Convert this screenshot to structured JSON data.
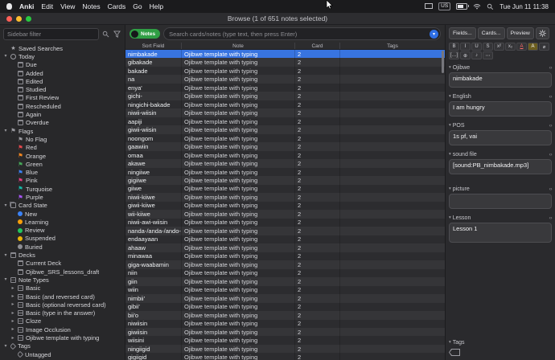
{
  "menubar": {
    "left_items": [
      "Anki",
      "Edit",
      "View",
      "Notes",
      "Cards",
      "Go",
      "Help"
    ],
    "input_source": "US",
    "time": "Tue Jun 11 11:38"
  },
  "titlebar": {
    "title": "Browse (1 of 651 notes selected)"
  },
  "toolbar": {
    "sidebar_filter_placeholder": "Sidebar filter",
    "notes_switch_label": "Notes",
    "search_placeholder": "Search cards/notes (type text, then press Enter)"
  },
  "right_toolbar": {
    "fields_button": "Fields...",
    "cards_button": "Cards...",
    "preview_button": "Preview"
  },
  "editor_toolbar": {
    "buttons": [
      {
        "name": "bold-button",
        "glyph": "B"
      },
      {
        "name": "italic-button",
        "glyph": "I"
      },
      {
        "name": "underline-button",
        "glyph": "U"
      },
      {
        "name": "strikethrough-button",
        "glyph": "S"
      },
      {
        "name": "superscript-button",
        "glyph": "x²"
      },
      {
        "name": "subscript-button",
        "glyph": "x₂"
      },
      {
        "name": "text-color-button",
        "glyph": "A",
        "style": "color-red"
      },
      {
        "name": "highlight-button",
        "glyph": "A",
        "style": "hl"
      },
      {
        "name": "eraser-button",
        "glyph": "⌀"
      },
      {
        "name": "cloze-button",
        "glyph": "[…]"
      },
      {
        "name": "attachment-button",
        "glyph": "⊕"
      },
      {
        "name": "record-audio-button",
        "glyph": "♪"
      },
      {
        "name": "more-button",
        "glyph": "⋯"
      }
    ]
  },
  "sidebar": {
    "sections": [
      {
        "label": "Saved Searches",
        "icon": "star",
        "children": []
      },
      {
        "label": "Today",
        "icon": "clock",
        "caret": "down",
        "children": [
          {
            "label": "Due",
            "icon": "cal"
          },
          {
            "label": "Added",
            "icon": "cal"
          },
          {
            "label": "Edited",
            "icon": "cal"
          },
          {
            "label": "Studied",
            "icon": "cal"
          },
          {
            "label": "First Review",
            "icon": "cal"
          },
          {
            "label": "Rescheduled",
            "icon": "cal"
          },
          {
            "label": "Again",
            "icon": "cal"
          },
          {
            "label": "Overdue",
            "icon": "cal"
          }
        ]
      },
      {
        "label": "Flags",
        "icon": "flag",
        "color": "#9a9aa0",
        "caret": "down",
        "children": [
          {
            "label": "No Flag",
            "icon": "flag",
            "color": "#9a9aa0"
          },
          {
            "label": "Red",
            "icon": "flag",
            "color": "#e5484d"
          },
          {
            "label": "Orange",
            "icon": "flag",
            "color": "#f5871f"
          },
          {
            "label": "Green",
            "icon": "flag",
            "color": "#46a758"
          },
          {
            "label": "Blue",
            "icon": "flag",
            "color": "#3b82f6"
          },
          {
            "label": "Pink",
            "icon": "flag",
            "color": "#e93d82"
          },
          {
            "label": "Turquoise",
            "icon": "flag",
            "color": "#14b8a6"
          },
          {
            "label": "Purple",
            "icon": "flag",
            "color": "#a855f7"
          }
        ]
      },
      {
        "label": "Card State",
        "icon": "cards",
        "caret": "down",
        "children": [
          {
            "label": "New",
            "icon": "dot",
            "color": "#3b82f6"
          },
          {
            "label": "Learning",
            "icon": "dot",
            "color": "#f59e0b"
          },
          {
            "label": "Review",
            "icon": "dot",
            "color": "#22c55e"
          },
          {
            "label": "Suspended",
            "icon": "dot",
            "color": "#eab308"
          },
          {
            "label": "Buried",
            "icon": "dot",
            "color": "#8e8e93"
          }
        ]
      },
      {
        "label": "Decks",
        "icon": "deck",
        "caret": "down",
        "children": [
          {
            "label": "Current Deck",
            "icon": "deck"
          },
          {
            "label": "Ojibwe_SRS_lessons_draft",
            "icon": "deck"
          }
        ]
      },
      {
        "label": "Note Types",
        "icon": "note",
        "caret": "down",
        "children": [
          {
            "label": "Basic",
            "icon": "note",
            "caret": "right"
          },
          {
            "label": "Basic (and reversed card)",
            "icon": "note",
            "caret": "right"
          },
          {
            "label": "Basic (optional reversed card)",
            "icon": "note",
            "caret": "right"
          },
          {
            "label": "Basic (type in the answer)",
            "icon": "note",
            "caret": "right"
          },
          {
            "label": "Cloze",
            "icon": "note",
            "caret": "right"
          },
          {
            "label": "Image Occlusion",
            "icon": "note",
            "caret": "right"
          },
          {
            "label": "Ojibwe template with typing",
            "icon": "note",
            "caret": "right"
          }
        ]
      },
      {
        "label": "Tags",
        "icon": "tag",
        "caret": "down",
        "children": [
          {
            "label": "Untagged",
            "icon": "tag"
          }
        ]
      }
    ]
  },
  "table": {
    "columns": [
      "Sort Field",
      "Note",
      "Card",
      "Tags"
    ],
    "rows": [
      {
        "sort_field": "nimbakade",
        "note": "Ojibwe template with typing",
        "card": "2",
        "tags": "",
        "selected": true
      },
      {
        "sort_field": "gibakade",
        "note": "Ojibwe template with typing",
        "card": "2",
        "tags": ""
      },
      {
        "sort_field": "bakade",
        "note": "Ojibwe template with typing",
        "card": "2",
        "tags": ""
      },
      {
        "sort_field": "na",
        "note": "Ojibwe template with typing",
        "card": "2",
        "tags": ""
      },
      {
        "sort_field": "enya'",
        "note": "Ojibwe template with typing",
        "card": "2",
        "tags": ""
      },
      {
        "sort_field": "gichi-",
        "note": "Ojibwe template with typing",
        "card": "2",
        "tags": ""
      },
      {
        "sort_field": "ningichi-bakade",
        "note": "Ojibwe template with typing",
        "card": "2",
        "tags": ""
      },
      {
        "sort_field": "niwii-wiisin",
        "note": "Ojibwe template with typing",
        "card": "2",
        "tags": ""
      },
      {
        "sort_field": "aapiji",
        "note": "Ojibwe template with typing",
        "card": "2",
        "tags": ""
      },
      {
        "sort_field": "giwii-wiisin",
        "note": "Ojibwe template with typing",
        "card": "2",
        "tags": ""
      },
      {
        "sort_field": "noongom",
        "note": "Ojibwe template with typing",
        "card": "2",
        "tags": ""
      },
      {
        "sort_field": "gaawiin",
        "note": "Ojibwe template with typing",
        "card": "2",
        "tags": ""
      },
      {
        "sort_field": "omaa",
        "note": "Ojibwe template with typing",
        "card": "2",
        "tags": ""
      },
      {
        "sort_field": "akawe",
        "note": "Ojibwe template with typing",
        "card": "2",
        "tags": ""
      },
      {
        "sort_field": "ningiiwe",
        "note": "Ojibwe template with typing",
        "card": "2",
        "tags": ""
      },
      {
        "sort_field": "gigiiwe",
        "note": "Ojibwe template with typing",
        "card": "2",
        "tags": ""
      },
      {
        "sort_field": "giiwe",
        "note": "Ojibwe template with typing",
        "card": "2",
        "tags": ""
      },
      {
        "sort_field": "niwii-kiiwe",
        "note": "Ojibwe template with typing",
        "card": "2",
        "tags": ""
      },
      {
        "sort_field": "giwii-kiiwe",
        "note": "Ojibwe template with typing",
        "card": "2",
        "tags": ""
      },
      {
        "sort_field": "wii-kiiwe",
        "note": "Ojibwe template with typing",
        "card": "2",
        "tags": ""
      },
      {
        "sort_field": "niwii-awi-wiisin",
        "note": "Ojibwe template with typing",
        "card": "2",
        "tags": ""
      },
      {
        "sort_field": "nanda-/anda-/ando-",
        "note": "Ojibwe template with typing",
        "card": "2",
        "tags": ""
      },
      {
        "sort_field": "endaayaan",
        "note": "Ojibwe template with typing",
        "card": "2",
        "tags": ""
      },
      {
        "sort_field": "ahaaw",
        "note": "Ojibwe template with typing",
        "card": "2",
        "tags": ""
      },
      {
        "sort_field": "minawaa",
        "note": "Ojibwe template with typing",
        "card": "2",
        "tags": ""
      },
      {
        "sort_field": "giga-waabamin",
        "note": "Ojibwe template with typing",
        "card": "2",
        "tags": ""
      },
      {
        "sort_field": "niin",
        "note": "Ojibwe template with typing",
        "card": "2",
        "tags": ""
      },
      {
        "sort_field": "giin",
        "note": "Ojibwe template with typing",
        "card": "2",
        "tags": ""
      },
      {
        "sort_field": "wiin",
        "note": "Ojibwe template with typing",
        "card": "2",
        "tags": ""
      },
      {
        "sort_field": "nimbii'",
        "note": "Ojibwe template with typing",
        "card": "2",
        "tags": ""
      },
      {
        "sort_field": "gibii'",
        "note": "Ojibwe template with typing",
        "card": "2",
        "tags": ""
      },
      {
        "sort_field": "bii'o",
        "note": "Ojibwe template with typing",
        "card": "2",
        "tags": ""
      },
      {
        "sort_field": "niwiisin",
        "note": "Ojibwe template with typing",
        "card": "2",
        "tags": ""
      },
      {
        "sort_field": "giwiisin",
        "note": "Ojibwe template with typing",
        "card": "2",
        "tags": ""
      },
      {
        "sort_field": "wiisini",
        "note": "Ojibwe template with typing",
        "card": "2",
        "tags": ""
      },
      {
        "sort_field": "ningiigid",
        "note": "Ojibwe template with typing",
        "card": "2",
        "tags": ""
      },
      {
        "sort_field": "gigiigid",
        "note": "Ojibwe template with typing",
        "card": "2",
        "tags": ""
      }
    ]
  },
  "editor": {
    "fields": [
      {
        "label": "Ojibwe",
        "value": "nimbakade"
      },
      {
        "label": "English",
        "value": "I am hungry"
      },
      {
        "label": "POS",
        "value": "1s pf, vai"
      },
      {
        "label": "sound file",
        "value": "[sound:PB_nimbakade.mp3]"
      },
      {
        "label": "picture",
        "value": ""
      },
      {
        "label": "Lesson",
        "value": "Lesson 1"
      }
    ],
    "tags_label": "Tags"
  }
}
